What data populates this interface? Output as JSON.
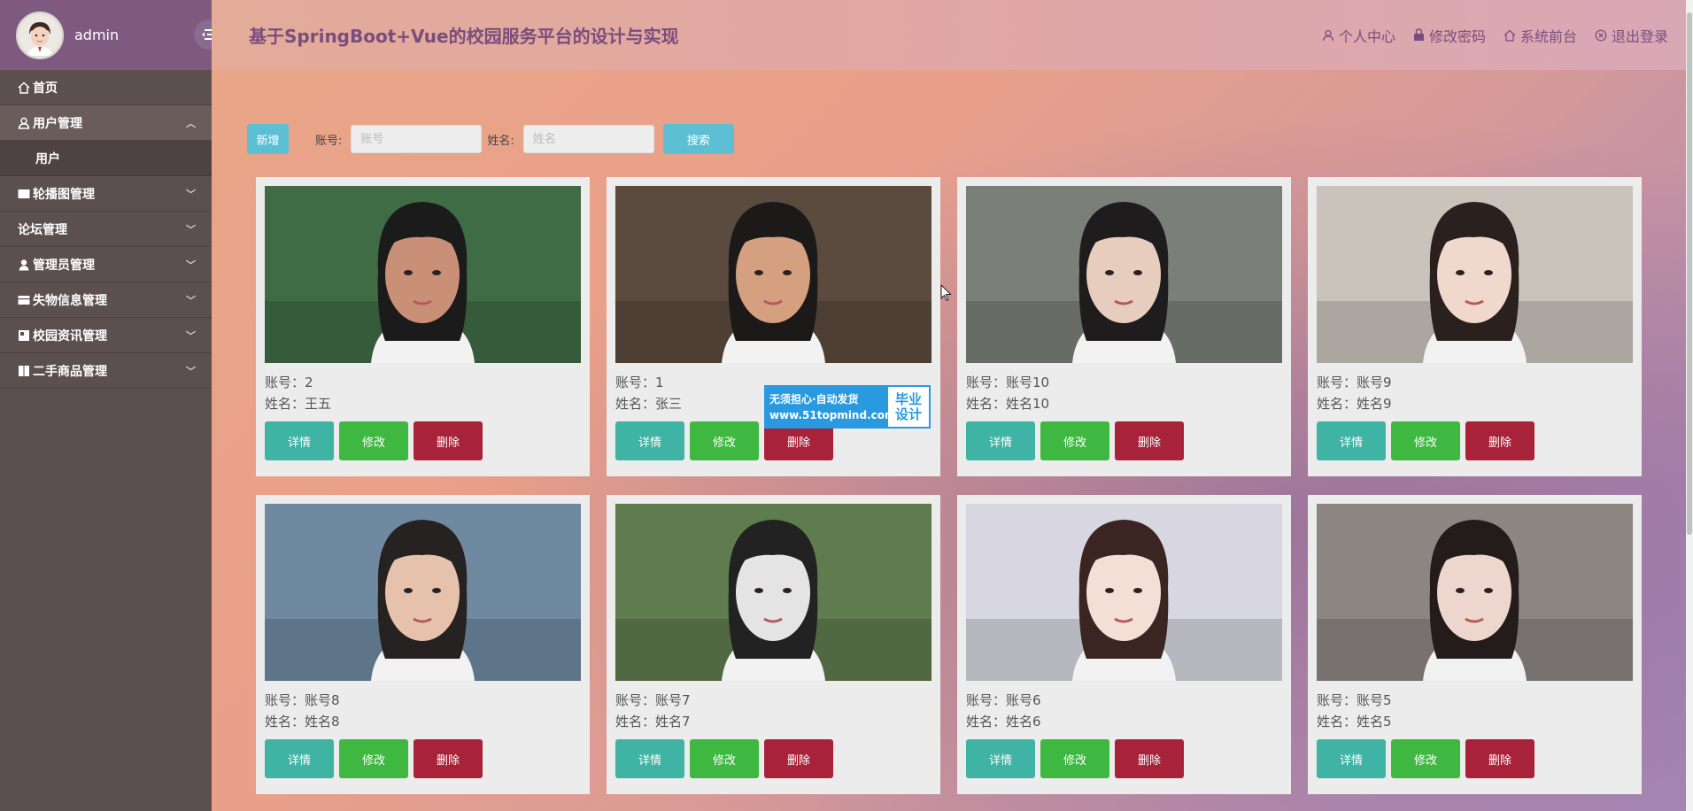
{
  "sidebar": {
    "username": "admin",
    "items": [
      {
        "label": "首页",
        "icon": "home-icon",
        "expandable": false
      },
      {
        "label": "用户管理",
        "icon": "user-icon",
        "expandable": true,
        "expanded": true
      },
      {
        "label": "轮播图管理",
        "icon": "banner-icon",
        "expandable": true
      },
      {
        "label": "论坛管理",
        "icon": "",
        "expandable": true
      },
      {
        "label": "管理员管理",
        "icon": "admin-icon",
        "expandable": true
      },
      {
        "label": "失物信息管理",
        "icon": "lost-icon",
        "expandable": true
      },
      {
        "label": "校园资讯管理",
        "icon": "news-icon",
        "expandable": true
      },
      {
        "label": "二手商品管理",
        "icon": "goods-icon",
        "expandable": true
      }
    ],
    "submenu": {
      "label": "用户"
    }
  },
  "header": {
    "title": "基于SpringBoot+Vue的校园服务平台的设计与实现",
    "nav": {
      "profile": "个人中心",
      "password": "修改密码",
      "frontend": "系统前台",
      "logout": "退出登录"
    }
  },
  "search": {
    "add_label": "新增",
    "account_label": "账号:",
    "account_placeholder": "账号",
    "name_label": "姓名:",
    "name_placeholder": "姓名",
    "search_label": "搜索"
  },
  "card_labels": {
    "account_prefix": "账号：",
    "name_prefix": "姓名：",
    "detail": "详情",
    "edit": "修改",
    "delete": "删除"
  },
  "cards": [
    {
      "account": "2",
      "name": "王五",
      "bg": "#3f6b45",
      "skin": "#c99077",
      "hair": "#1b1b1b"
    },
    {
      "account": "1",
      "name": "张三",
      "bg": "#5b4a3e",
      "skin": "#d4a07f",
      "hair": "#1c1a18"
    },
    {
      "account": "账号10",
      "name": "姓名10",
      "bg": "#7a7f79",
      "skin": "#e7cdbd",
      "hair": "#1e1c1d"
    },
    {
      "account": "账号9",
      "name": "姓名9",
      "bg": "#c9c3bc",
      "skin": "#f0d8cc",
      "hair": "#2a211e"
    },
    {
      "account": "账号8",
      "name": "姓名8",
      "bg": "#6f89a0",
      "skin": "#e6c2ac",
      "hair": "#272222"
    },
    {
      "account": "账号7",
      "name": "姓名7",
      "bg": "#5f7c4e",
      "skin": "#e4e4e4",
      "hair": "#222222"
    },
    {
      "account": "账号6",
      "name": "姓名6",
      "bg": "#d8d7e1",
      "skin": "#f4dfd6",
      "hair": "#3a2522"
    },
    {
      "account": "账号5",
      "name": "姓名5",
      "bg": "#8c8683",
      "skin": "#ecd6cd",
      "hair": "#241c1b"
    }
  ],
  "watermark": {
    "line1": "无须担心·自动发货",
    "line2": "www.51topmind.com",
    "right1": "毕业",
    "right2": "设计"
  },
  "colors": {
    "accent": "#5dbfd3",
    "detail": "#3fb3a4",
    "edit": "#3fb842",
    "delete": "#a8233a",
    "title": "#7a4d7e"
  }
}
